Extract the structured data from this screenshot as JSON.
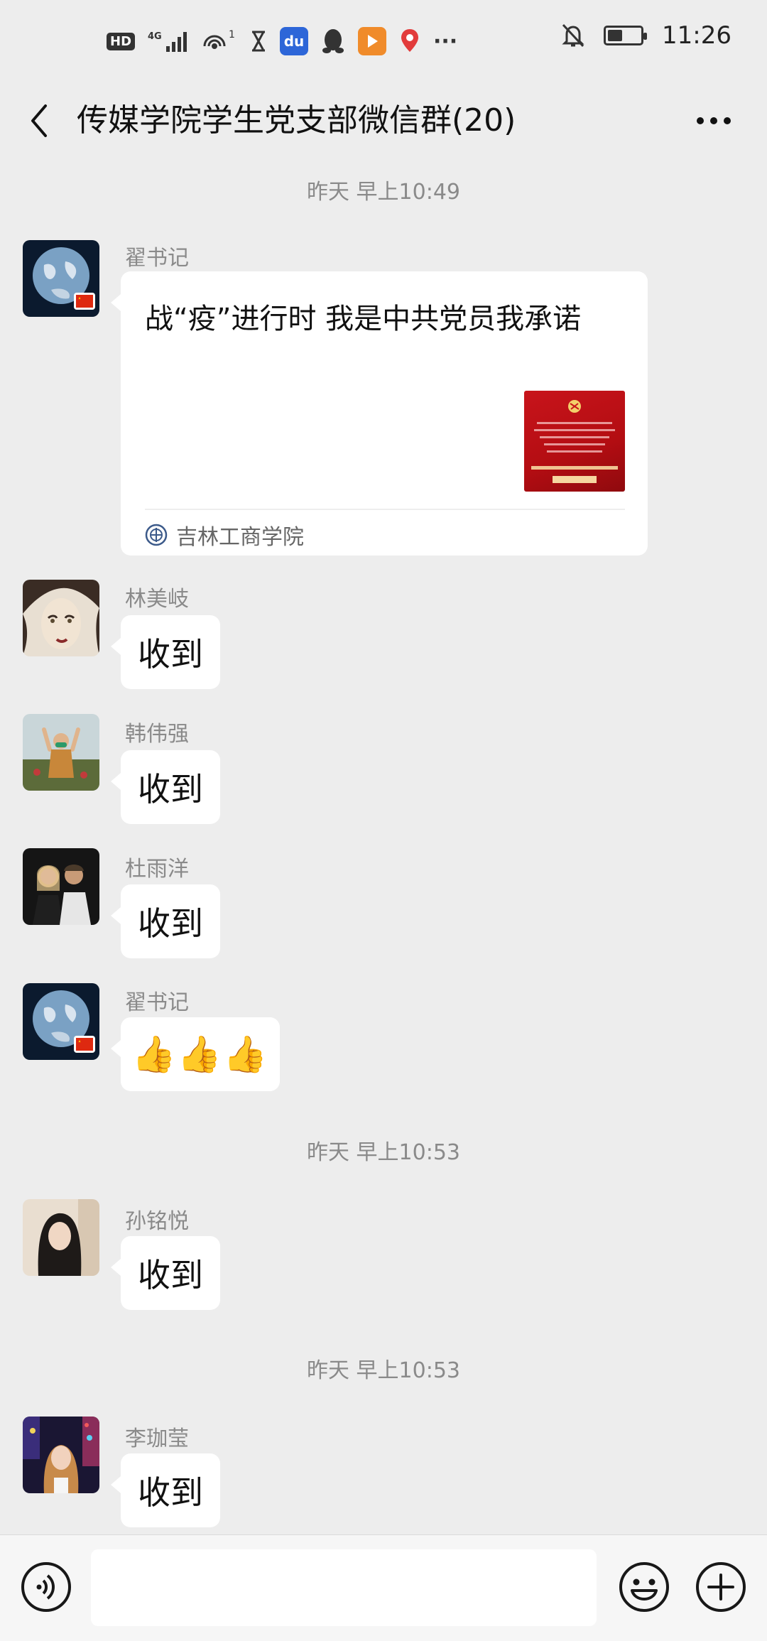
{
  "status_bar": {
    "hd": "HD",
    "network": "4G",
    "hotspot_count": "1",
    "time": "11:26",
    "more": "···",
    "battery_level": 0.45,
    "icons": [
      "signal-icon",
      "hotspot-icon",
      "hourglass-icon",
      "baidu-app-icon",
      "qq-app-icon",
      "video-app-icon",
      "map-app-icon",
      "mute-icon",
      "battery-icon"
    ]
  },
  "header": {
    "title": "传媒学院学生党支部微信群(20)",
    "back_icon": "chevron-left-icon",
    "more_icon": "more-dots-icon"
  },
  "timestamps": [
    "昨天 早上10:49",
    "昨天 早上10:53",
    "昨天 早上10:53"
  ],
  "messages": [
    {
      "sender": "翟书记",
      "type": "article",
      "title": "战“疫”进行时 我是中共党员我承诺",
      "source": "吉林工商学院"
    },
    {
      "sender": "林美岐",
      "type": "text",
      "text": "收到"
    },
    {
      "sender": "韩伟强",
      "type": "text",
      "text": "收到"
    },
    {
      "sender": "杜雨洋",
      "type": "text",
      "text": "收到"
    },
    {
      "sender": "翟书记",
      "type": "emoji",
      "text": "👍👍👍"
    },
    {
      "sender": "孙铭悦",
      "type": "text",
      "text": "收到"
    },
    {
      "sender": "李珈莹",
      "type": "text",
      "text": "收到"
    }
  ],
  "input_bar": {
    "placeholder": "",
    "voice_icon": "voice-icon",
    "emoji_icon": "emoji-icon",
    "plus_icon": "plus-icon"
  },
  "colors": {
    "background": "#ededed",
    "bubble": "#ffffff",
    "meta_text": "#8a8a8a",
    "thumb_red": "#c8141b"
  }
}
